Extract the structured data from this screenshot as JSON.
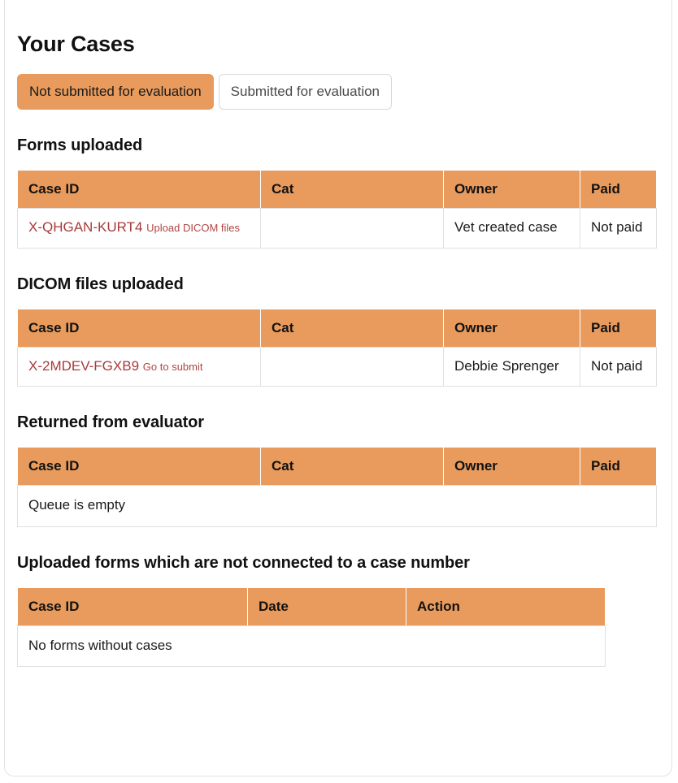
{
  "page": {
    "title": "Your Cases"
  },
  "tabs": [
    {
      "label": "Not submitted for evaluation",
      "state": "active"
    },
    {
      "label": "Submitted for evaluation",
      "state": "inactive"
    }
  ],
  "colors": {
    "accent_orange": "#e89b5c",
    "link_red": "#a8393a",
    "action_red": "#b24444",
    "border_gray": "#e0e0e0"
  },
  "sections": [
    {
      "heading": "Forms uploaded",
      "columns": [
        "Case ID",
        "Cat",
        "Owner",
        "Paid"
      ],
      "rows": [
        {
          "case_id": "X-QHGAN-KURT4",
          "action": "Upload DICOM files",
          "cat": "",
          "owner": "Vet created case",
          "paid": "Not paid"
        }
      ],
      "empty_message": ""
    },
    {
      "heading": "DICOM files uploaded",
      "columns": [
        "Case ID",
        "Cat",
        "Owner",
        "Paid"
      ],
      "rows": [
        {
          "case_id": "X-2MDEV-FGXB9",
          "action": "Go to submit",
          "cat": "",
          "owner": "Debbie Sprenger",
          "paid": "Not paid"
        }
      ],
      "empty_message": ""
    },
    {
      "heading": "Returned from evaluator",
      "columns": [
        "Case ID",
        "Cat",
        "Owner",
        "Paid"
      ],
      "rows": [],
      "empty_message": "Queue is empty"
    },
    {
      "heading": "Uploaded forms which are not connected to a case number",
      "columns": [
        "Case ID",
        "Date",
        "Action"
      ],
      "rows": [],
      "empty_message": "No forms without cases"
    }
  ]
}
